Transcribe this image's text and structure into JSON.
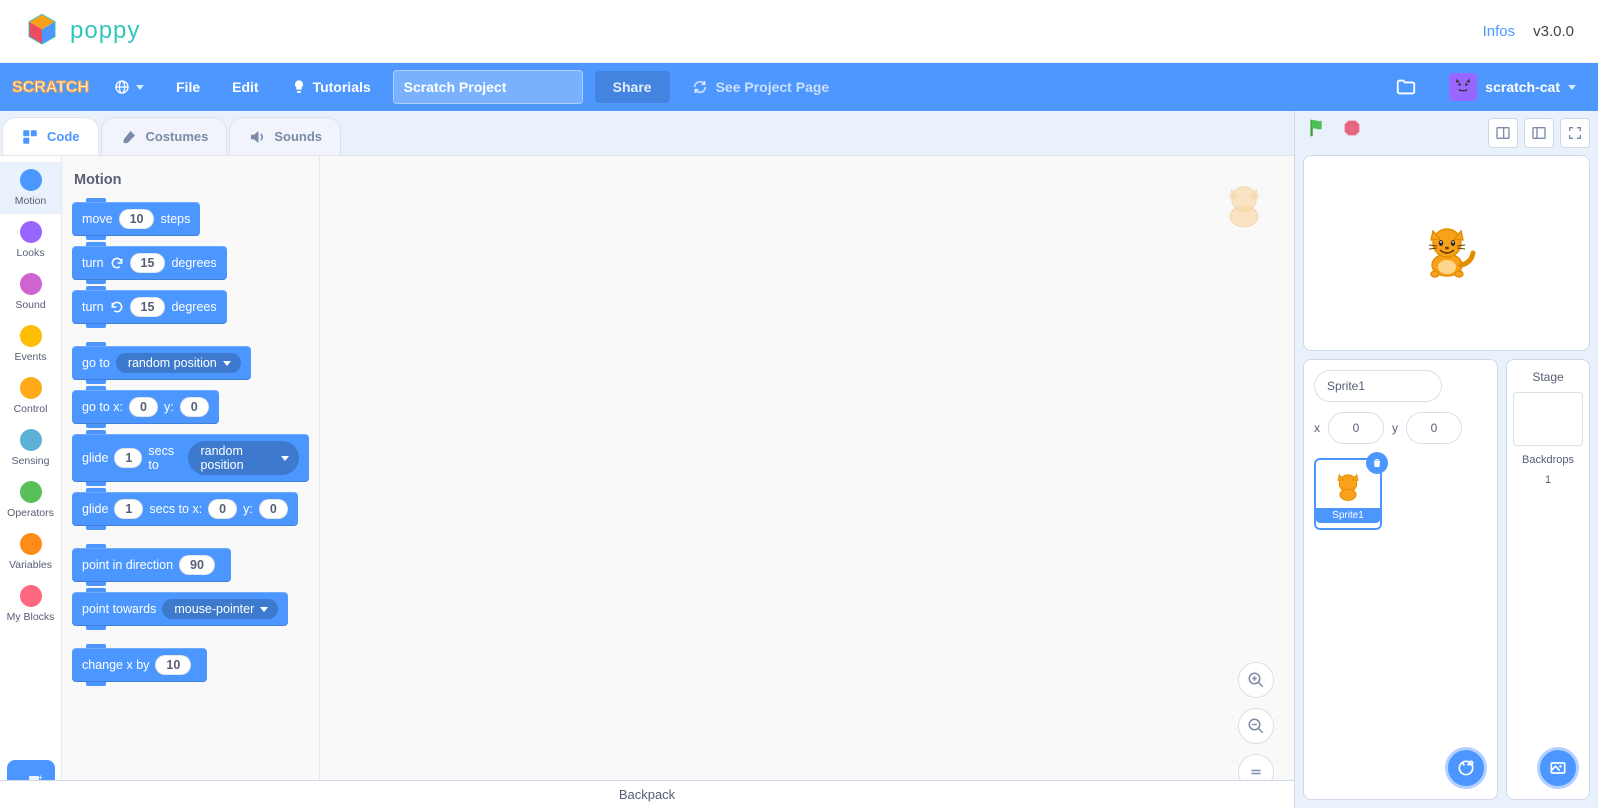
{
  "topbar": {
    "brand": "poppy",
    "infos": "Infos",
    "version": "v3.0.0"
  },
  "menubar": {
    "logo_text": "SCRATCH",
    "file": "File",
    "edit": "Edit",
    "tutorials": "Tutorials",
    "project_title": "Scratch Project",
    "share": "Share",
    "see_project": "See Project Page",
    "username": "scratch-cat"
  },
  "tabs": {
    "code": "Code",
    "costumes": "Costumes",
    "sounds": "Sounds"
  },
  "categories": [
    {
      "name": "Motion",
      "color": "#4c97ff",
      "selected": true
    },
    {
      "name": "Looks",
      "color": "#9966ff"
    },
    {
      "name": "Sound",
      "color": "#cf63cf"
    },
    {
      "name": "Events",
      "color": "#ffbf00"
    },
    {
      "name": "Control",
      "color": "#ffab19"
    },
    {
      "name": "Sensing",
      "color": "#5cb1d6"
    },
    {
      "name": "Operators",
      "color": "#59c059"
    },
    {
      "name": "Variables",
      "color": "#ff8c1a"
    },
    {
      "name": "My Blocks",
      "color": "#ff6680"
    }
  ],
  "palette": {
    "heading": "Motion",
    "blocks": [
      {
        "type": "pills",
        "pre": "move",
        "pill": "10",
        "post": "steps"
      },
      {
        "type": "turn_cw",
        "pre": "turn",
        "pill": "15",
        "post": "degrees"
      },
      {
        "type": "turn_ccw",
        "pre": "turn",
        "pill": "15",
        "post": "degrees"
      },
      {
        "type": "gap"
      },
      {
        "type": "dropdown",
        "pre": "go to",
        "dd": "random position"
      },
      {
        "type": "xy",
        "pre": "go to x:",
        "x": "0",
        "mid": "y:",
        "y": "0"
      },
      {
        "type": "glide_dd",
        "pre": "glide",
        "s": "1",
        "mid": "secs to",
        "dd": "random position"
      },
      {
        "type": "glide_xy",
        "pre": "glide",
        "s": "1",
        "mid": "secs to x:",
        "x": "0",
        "mid2": "y:",
        "y": "0"
      },
      {
        "type": "gap"
      },
      {
        "type": "pills",
        "pre": "point in direction",
        "pill": "90",
        "post": ""
      },
      {
        "type": "dropdown",
        "pre": "point towards",
        "dd": "mouse-pointer"
      },
      {
        "type": "gap"
      },
      {
        "type": "pills",
        "pre": "change x by",
        "pill": "10",
        "post": ""
      }
    ]
  },
  "sprite_info": {
    "name_value": "Sprite1",
    "x_label": "x",
    "x_value": "0",
    "y_label": "y",
    "y_value": "0"
  },
  "sprite_tile": {
    "label": "Sprite1"
  },
  "stage": {
    "title": "Stage",
    "backdrops_label": "Backdrops",
    "backdrops_count": "1"
  },
  "backpack": "Backpack"
}
